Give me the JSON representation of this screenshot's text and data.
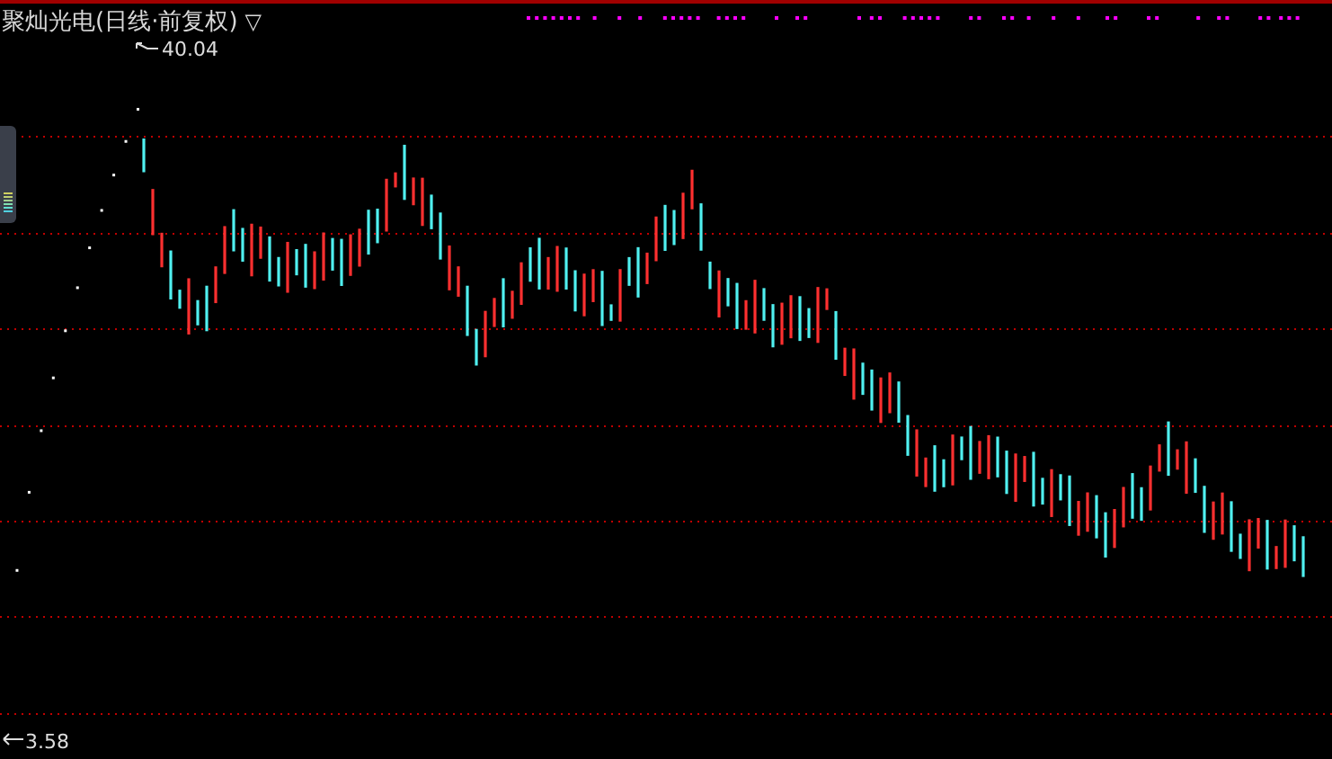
{
  "header": {
    "title": "聚灿光电(日线·前复权)",
    "menu_glyph": "▽"
  },
  "chart": {
    "high_label": "40.04",
    "low_label": "3.58"
  }
}
